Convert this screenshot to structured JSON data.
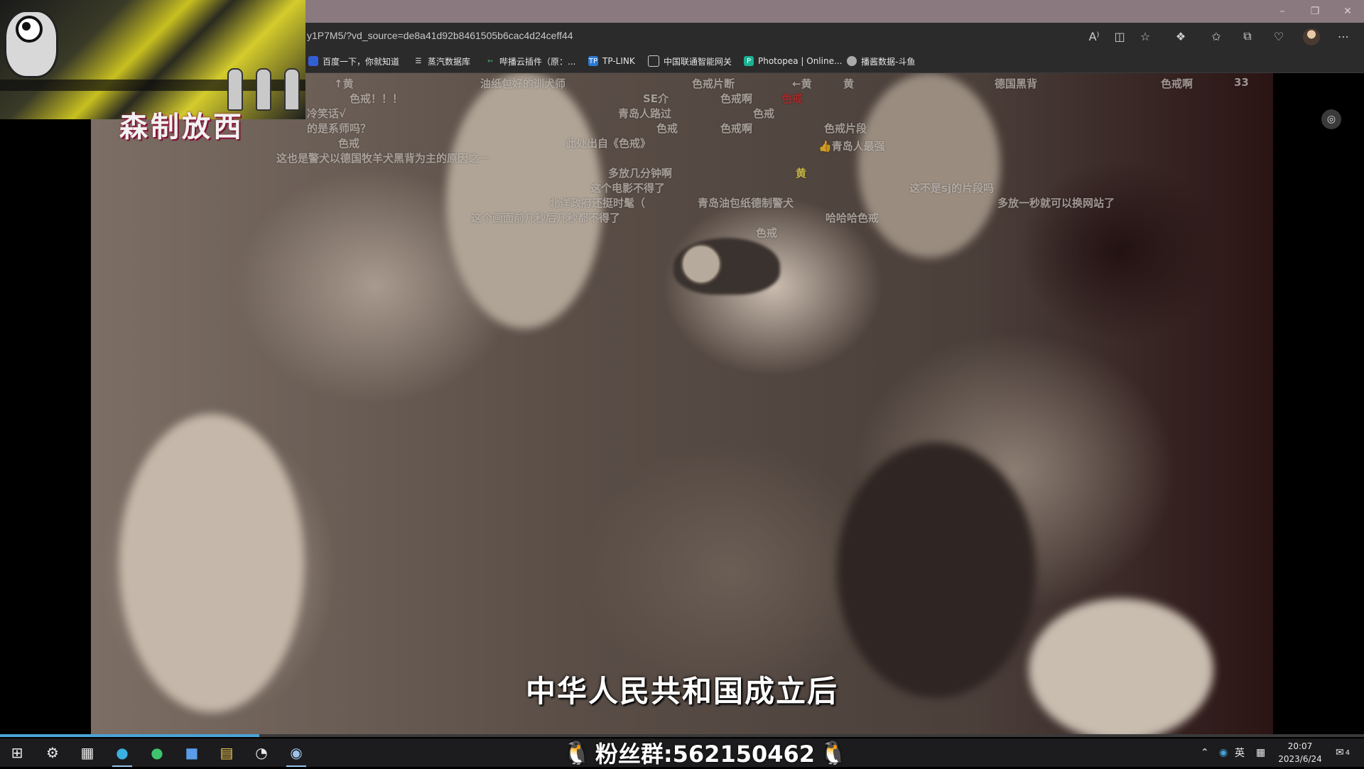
{
  "browser": {
    "url": "y1P7M5/?vd_source=de8a41d92b8461505b6cac4d24ceff44",
    "window_controls": [
      "minimize-icon",
      "restore-icon",
      "close-icon"
    ],
    "toolbar_icons": [
      "read-aloud-icon",
      "split-screen-icon",
      "add-favorite-icon",
      "extensions-icon",
      "favorites-icon",
      "collections-icon",
      "browser-essentials-icon",
      "profile-icon",
      "more-icon"
    ],
    "bookmarks": [
      {
        "label": "百度一下，你就知道",
        "icon": "baidu-icon",
        "color": "#3a5bd9"
      },
      {
        "label": "蒸汽数据库",
        "icon": "database-icon",
        "color": "#e6e6e6"
      },
      {
        "label": "哔播云插件（原：...",
        "icon": "plugin-icon",
        "color": "#3ec46d"
      },
      {
        "label": "TP-LINK",
        "icon": "tplink-icon",
        "color": "#2a7bd6"
      },
      {
        "label": "中国联通智能网关",
        "icon": "page-icon",
        "color": "#e6e6e6"
      },
      {
        "label": "Photopea | Online...",
        "icon": "photopea-icon",
        "color": "#1ab394"
      },
      {
        "label": "播酱数据-斗鱼",
        "icon": "douyu-icon",
        "color": "#e6e6e6"
      }
    ]
  },
  "overlay": {
    "title": "森制放西"
  },
  "video": {
    "subtitle": "中华人民共和国成立后",
    "progress_fraction": 0.19,
    "danmaku": [
      {
        "text": "↑黄",
        "color": "default"
      },
      {
        "text": "油纸包好的训犬师",
        "color": "default"
      },
      {
        "text": "色戒片断",
        "color": "default"
      },
      {
        "text": "←黄",
        "color": "default"
      },
      {
        "text": "黄",
        "color": "default"
      },
      {
        "text": "德国黑背",
        "color": "default"
      },
      {
        "text": "色戒啊",
        "color": "default"
      },
      {
        "text": "33",
        "color": "default"
      },
      {
        "text": "色戒！！！",
        "color": "default"
      },
      {
        "text": "SE介",
        "color": "default"
      },
      {
        "text": "色戒啊",
        "color": "default"
      },
      {
        "text": "色戒",
        "color": "red"
      },
      {
        "text": "冷笑话√",
        "color": "default"
      },
      {
        "text": "青岛人路过",
        "color": "default"
      },
      {
        "text": "色戒",
        "color": "default"
      },
      {
        "text": "的是系师吗？",
        "color": "default"
      },
      {
        "text": "色戒",
        "color": "default"
      },
      {
        "text": "色戒啊",
        "color": "default"
      },
      {
        "text": "色戒片段",
        "color": "default"
      },
      {
        "text": "色戒",
        "color": "default"
      },
      {
        "text": "此处出自《色戒》",
        "color": "default"
      },
      {
        "text": "👍青岛人最强",
        "color": "default"
      },
      {
        "text": "这也是警犬以德国牧羊犬黑背为主的原因之一",
        "color": "default"
      },
      {
        "text": "多放几分钟啊",
        "color": "default"
      },
      {
        "text": "黄",
        "color": "yellow"
      },
      {
        "text": "这个电影不得了",
        "color": "default"
      },
      {
        "text": "这不是sj的片段吗",
        "color": "default"
      },
      {
        "text": "北洋政府还挺时髦（",
        "color": "default"
      },
      {
        "text": "青岛油包纸德制警犬",
        "color": "default"
      },
      {
        "text": "多放一秒就可以换网站了",
        "color": "default"
      },
      {
        "text": "这个画面前几秒后几秒都不得了",
        "color": "default"
      },
      {
        "text": "哈哈哈色戒",
        "color": "default"
      },
      {
        "text": "色戒",
        "color": "default"
      }
    ]
  },
  "taskbar": {
    "apps": [
      "windows-start-icon",
      "settings-icon",
      "calculator-icon",
      "edge-icon",
      "app-green-icon",
      "app-blue-icon",
      "file-explorer-icon",
      "app-circle-icon",
      "steam-icon"
    ],
    "fans_text": "粉丝群:562150462",
    "ime": "英",
    "time": "20:07",
    "date": "2023/6/24",
    "notifications": "4"
  },
  "colors": {
    "accent": "#4aa3d8",
    "titlebar": "#8a7a80",
    "toolbar": "#2b2b2b",
    "taskbar": "#1c1c1e"
  }
}
